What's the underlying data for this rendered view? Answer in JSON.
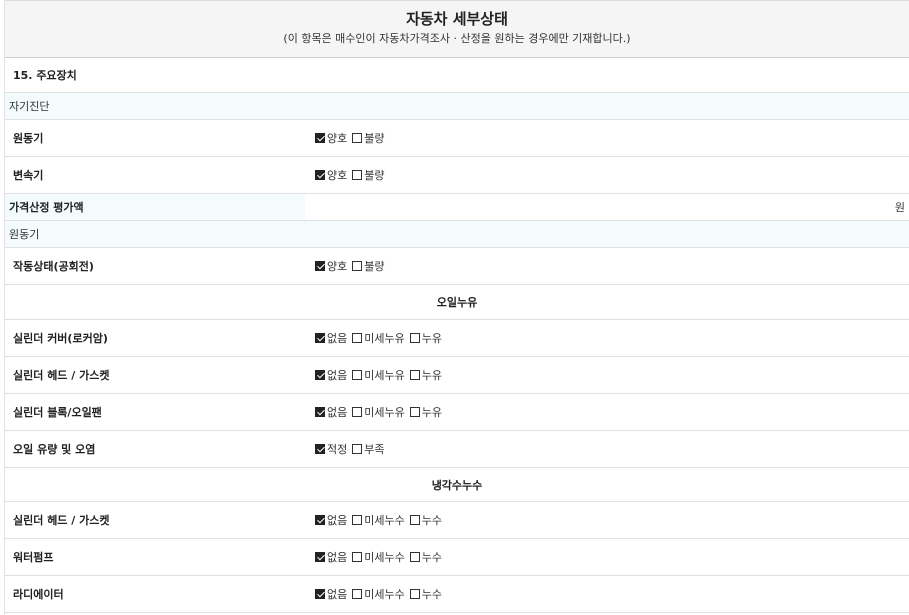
{
  "header": {
    "title": "자동차 세부상태",
    "subtitle": "(이 항목은 매수인이 자동차가격조사 · 산정을 원하는 경우에만 기재합니다.)"
  },
  "section_title": "15. 주요장치",
  "self_diagnosis": {
    "title": "자기진단",
    "items": [
      {
        "label": "원동기",
        "options": [
          {
            "text": "양호",
            "checked": true
          },
          {
            "text": "불량",
            "checked": false
          }
        ]
      },
      {
        "label": "변속기",
        "options": [
          {
            "text": "양호",
            "checked": true
          },
          {
            "text": "불량",
            "checked": false
          }
        ]
      }
    ]
  },
  "price": {
    "label": "가격산정 평가액",
    "unit": "원"
  },
  "engine": {
    "title": "원동기",
    "items": [
      {
        "label": "작동상태(공회전)",
        "options": [
          {
            "text": "양호",
            "checked": true
          },
          {
            "text": "불량",
            "checked": false
          }
        ]
      }
    ]
  },
  "oil_leak": {
    "title": "오일누유",
    "items": [
      {
        "label": "실린더 커버(로커암)",
        "options": [
          {
            "text": "없음",
            "checked": true
          },
          {
            "text": "미세누유",
            "checked": false
          },
          {
            "text": "누유",
            "checked": false
          }
        ]
      },
      {
        "label": "실린더 헤드 / 가스켓",
        "options": [
          {
            "text": "없음",
            "checked": true
          },
          {
            "text": "미세누유",
            "checked": false
          },
          {
            "text": "누유",
            "checked": false
          }
        ]
      },
      {
        "label": "실린더 블록/오일팬",
        "options": [
          {
            "text": "없음",
            "checked": true
          },
          {
            "text": "미세누유",
            "checked": false
          },
          {
            "text": "누유",
            "checked": false
          }
        ]
      },
      {
        "label": "오일 유량 및 오염",
        "options": [
          {
            "text": "적정",
            "checked": true
          },
          {
            "text": "부족",
            "checked": false
          }
        ]
      }
    ]
  },
  "coolant_leak": {
    "title": "냉각수누수",
    "items": [
      {
        "label": "실린더 헤드 / 가스켓",
        "options": [
          {
            "text": "없음",
            "checked": true
          },
          {
            "text": "미세누수",
            "checked": false
          },
          {
            "text": "누수",
            "checked": false
          }
        ]
      },
      {
        "label": "워터펌프",
        "options": [
          {
            "text": "없음",
            "checked": true
          },
          {
            "text": "미세누수",
            "checked": false
          },
          {
            "text": "누수",
            "checked": false
          }
        ]
      },
      {
        "label": "라디에이터",
        "options": [
          {
            "text": "없음",
            "checked": true
          },
          {
            "text": "미세누수",
            "checked": false
          },
          {
            "text": "누수",
            "checked": false
          }
        ]
      }
    ]
  }
}
